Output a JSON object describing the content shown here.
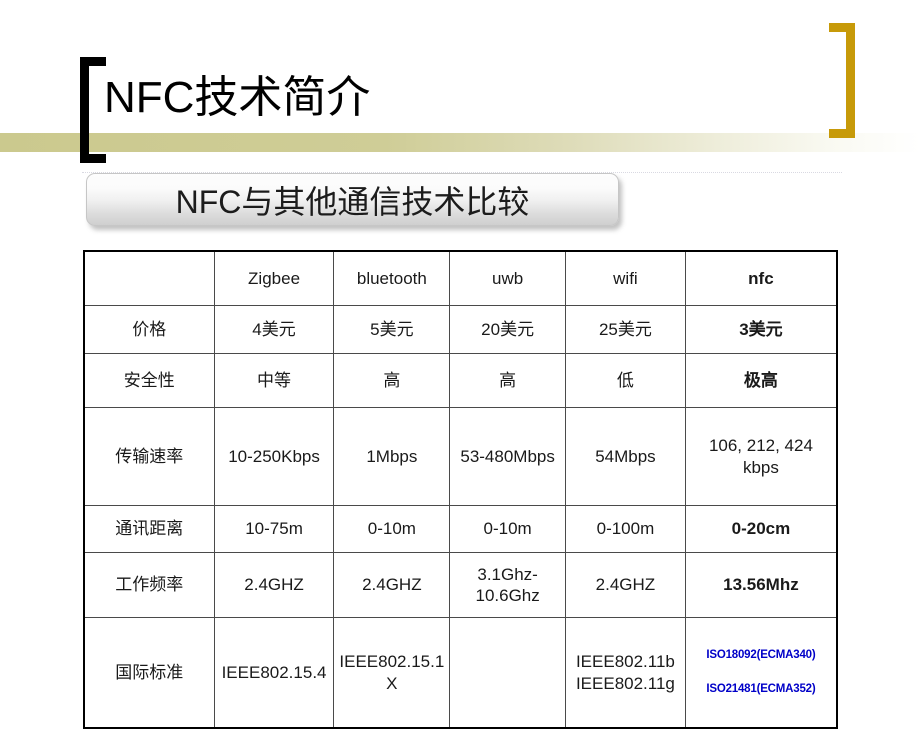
{
  "slide": {
    "title": "NFC技术简介",
    "subtitle": "NFC与其他通信技术比较",
    "accent_gold": "#c79a09",
    "accent_olive": "#cbc98e",
    "accent_blue": "#0000c8",
    "accent_red": "#ff0000"
  },
  "table": {
    "corner_label": "",
    "columns": [
      "",
      "Zigbee",
      "bluetooth",
      "uwb",
      "wifi",
      "nfc"
    ],
    "rows": [
      {
        "label": "价格",
        "cells": [
          "4美元",
          "5美元",
          "20美元",
          "25美元"
        ],
        "nfc": "3美元"
      },
      {
        "label": "安全性",
        "cells": [
          "中等",
          "高",
          "高",
          "低"
        ],
        "nfc": "极高"
      },
      {
        "label": "传输速率",
        "cells": [
          "10-250Kbps",
          "1Mbps",
          "53-480Mbps",
          "54Mbps"
        ],
        "nfc": "106, 212, 424 kbps"
      },
      {
        "label": "通讯距离",
        "cells": [
          "10-75m",
          "0-10m",
          "0-10m",
          "0-100m"
        ],
        "nfc": "0-20cm"
      },
      {
        "label": "工作频率",
        "cells": [
          "2.4GHZ",
          "2.4GHZ",
          "3.1Ghz-10.6Ghz",
          "2.4GHZ"
        ],
        "nfc": "13.56Mhz"
      },
      {
        "label": "国际标准",
        "cells": [
          "IEEE802.15.4",
          "IEEE802.15.1X",
          "",
          "IEEE802.11b IEEE802.11g"
        ],
        "nfc_line1": "ISO18092(ECMA340)",
        "nfc_line2": "ISO21481(ECMA352)"
      }
    ]
  }
}
